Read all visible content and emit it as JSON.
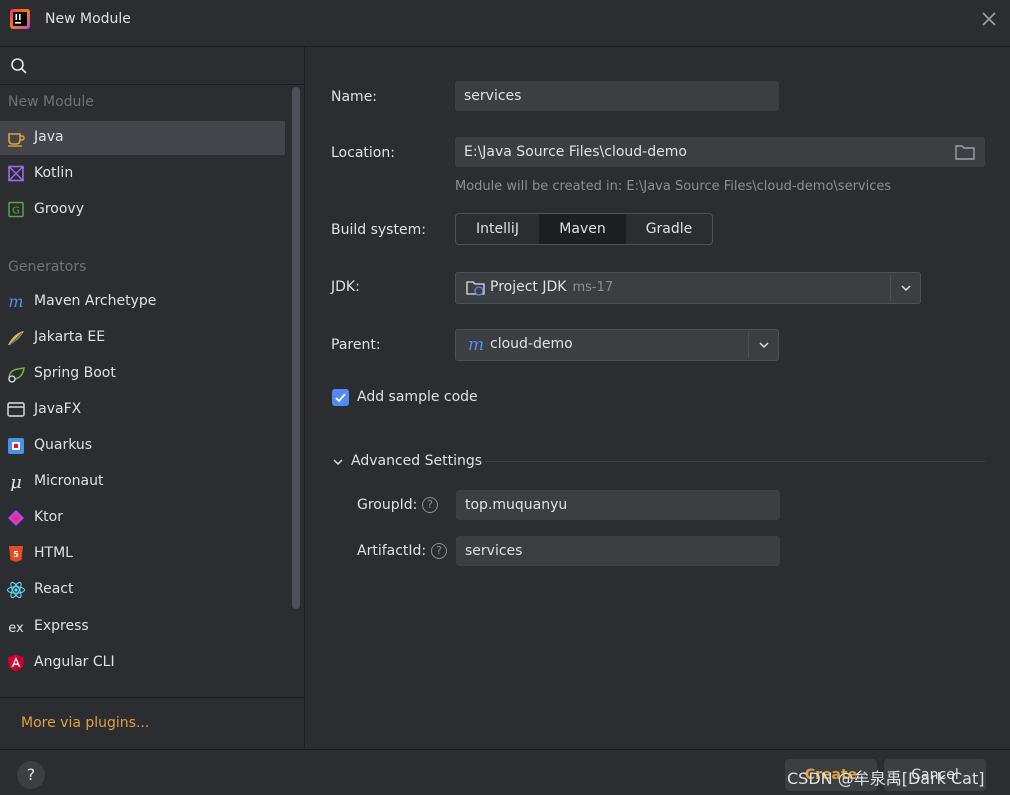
{
  "window": {
    "title": "New Module",
    "close_icon": "close-icon"
  },
  "sidebar": {
    "search_icon": "search-icon",
    "section_new_module": "New Module",
    "new_module_items": [
      {
        "label": "Java",
        "icon": "java-icon",
        "selected": true
      },
      {
        "label": "Kotlin",
        "icon": "kotlin-icon"
      },
      {
        "label": "Groovy",
        "icon": "groovy-icon"
      }
    ],
    "section_generators": "Generators",
    "generator_items": [
      {
        "label": "Maven Archetype",
        "icon": "maven-icon"
      },
      {
        "label": "Jakarta EE",
        "icon": "jakarta-icon"
      },
      {
        "label": "Spring Boot",
        "icon": "spring-icon"
      },
      {
        "label": "JavaFX",
        "icon": "javafx-icon"
      },
      {
        "label": "Quarkus",
        "icon": "quarkus-icon"
      },
      {
        "label": "Micronaut",
        "icon": "micronaut-icon"
      },
      {
        "label": "Ktor",
        "icon": "ktor-icon"
      },
      {
        "label": "HTML",
        "icon": "html-icon"
      },
      {
        "label": "React",
        "icon": "react-icon"
      },
      {
        "label": "Express",
        "icon": "express-icon"
      },
      {
        "label": "Angular CLI",
        "icon": "angular-icon"
      }
    ],
    "more_link": "More via plugins..."
  },
  "form": {
    "name_label": "Name:",
    "name_value": "services",
    "location_label": "Location:",
    "location_value": "E:\\Java Source Files\\cloud-demo",
    "location_hint": "Module will be created in: E:\\Java Source Files\\cloud-demo\\services",
    "build_label": "Build system:",
    "build_options": [
      "IntelliJ",
      "Maven",
      "Gradle"
    ],
    "build_selected": "Maven",
    "jdk_label": "JDK:",
    "jdk_value": "Project JDK",
    "jdk_sub": "ms-17",
    "parent_label": "Parent:",
    "parent_value": "cloud-demo",
    "sample_code_label": "Add sample code",
    "sample_code_checked": true,
    "advanced_label": "Advanced Settings",
    "groupid_label": "GroupId:",
    "groupid_value": "top.muquanyu",
    "artifactid_label": "ArtifactId:",
    "artifactid_value": "services",
    "help_glyph": "?"
  },
  "footer": {
    "help_glyph": "?",
    "create_label": "Create",
    "cancel_label": "Cancel",
    "watermark": "CSDN @牟泉禹[Dark Cat]"
  },
  "colors": {
    "accent_orange": "#e2a03f",
    "checkbox_blue": "#548af7",
    "background": "#2b2d30"
  }
}
